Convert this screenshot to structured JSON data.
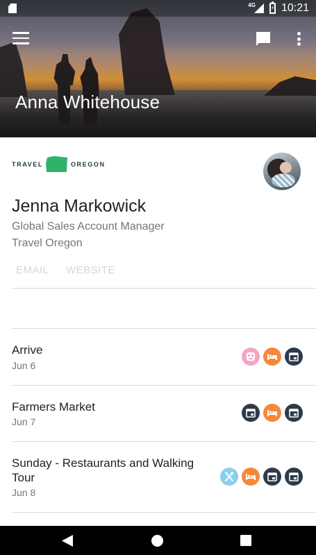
{
  "status_bar": {
    "network": "4G",
    "time": "10:21"
  },
  "header": {
    "title": "Anna Whitehouse"
  },
  "profile": {
    "logo_left": "TRAVEL",
    "logo_right": "OREGON",
    "brand_color": "#2fb36b",
    "name": "Jenna Markowick",
    "role": "Global Sales Account Manager",
    "organization": "Travel Oregon",
    "email_label": "EMAIL",
    "website_label": "WEBSITE"
  },
  "itinerary": [
    {
      "title": "Arrive",
      "date": "Jun 6",
      "icons": [
        "attraction-icon",
        "lodging-icon",
        "calendar-icon"
      ]
    },
    {
      "title": "Farmers Market",
      "date": "Jun 7",
      "icons": [
        "calendar-icon",
        "lodging-icon",
        "calendar-icon"
      ]
    },
    {
      "title": "Sunday - Restaurants and Walking Tour",
      "date": "Jun 8",
      "icons": [
        "dining-icon",
        "lodging-icon",
        "calendar-icon",
        "calendar-icon"
      ]
    }
  ],
  "colors": {
    "attraction": "#f3a5c8",
    "lodging": "#f5883a",
    "calendar": "#2d3a4c",
    "dining": "#8ad0ee"
  }
}
